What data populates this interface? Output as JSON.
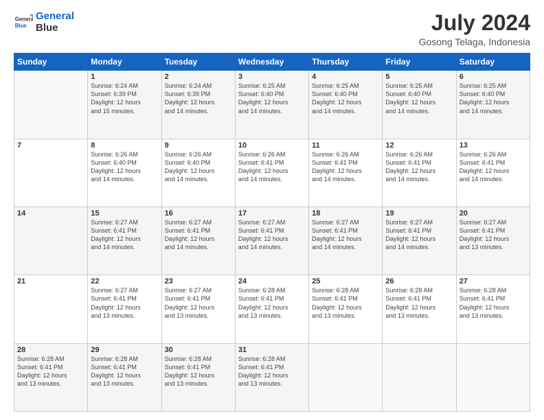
{
  "header": {
    "logo_line1": "General",
    "logo_line2": "Blue",
    "title": "July 2024",
    "subtitle": "Gosong Telaga, Indonesia"
  },
  "weekdays": [
    "Sunday",
    "Monday",
    "Tuesday",
    "Wednesday",
    "Thursday",
    "Friday",
    "Saturday"
  ],
  "weeks": [
    [
      {
        "day": "",
        "info": ""
      },
      {
        "day": "1",
        "info": "Sunrise: 6:24 AM\nSunset: 6:39 PM\nDaylight: 12 hours\nand 15 minutes."
      },
      {
        "day": "2",
        "info": "Sunrise: 6:24 AM\nSunset: 6:39 PM\nDaylight: 12 hours\nand 14 minutes."
      },
      {
        "day": "3",
        "info": "Sunrise: 6:25 AM\nSunset: 6:40 PM\nDaylight: 12 hours\nand 14 minutes."
      },
      {
        "day": "4",
        "info": "Sunrise: 6:25 AM\nSunset: 6:40 PM\nDaylight: 12 hours\nand 14 minutes."
      },
      {
        "day": "5",
        "info": "Sunrise: 6:25 AM\nSunset: 6:40 PM\nDaylight: 12 hours\nand 14 minutes."
      },
      {
        "day": "6",
        "info": "Sunrise: 6:25 AM\nSunset: 6:40 PM\nDaylight: 12 hours\nand 14 minutes."
      }
    ],
    [
      {
        "day": "7",
        "info": ""
      },
      {
        "day": "8",
        "info": "Sunrise: 6:26 AM\nSunset: 6:40 PM\nDaylight: 12 hours\nand 14 minutes."
      },
      {
        "day": "9",
        "info": "Sunrise: 6:26 AM\nSunset: 6:40 PM\nDaylight: 12 hours\nand 14 minutes."
      },
      {
        "day": "10",
        "info": "Sunrise: 6:26 AM\nSunset: 6:41 PM\nDaylight: 12 hours\nand 14 minutes."
      },
      {
        "day": "11",
        "info": "Sunrise: 6:26 AM\nSunset: 6:41 PM\nDaylight: 12 hours\nand 14 minutes."
      },
      {
        "day": "12",
        "info": "Sunrise: 6:26 AM\nSunset: 6:41 PM\nDaylight: 12 hours\nand 14 minutes."
      },
      {
        "day": "13",
        "info": "Sunrise: 6:26 AM\nSunset: 6:41 PM\nDaylight: 12 hours\nand 14 minutes."
      }
    ],
    [
      {
        "day": "14",
        "info": ""
      },
      {
        "day": "15",
        "info": "Sunrise: 6:27 AM\nSunset: 6:41 PM\nDaylight: 12 hours\nand 14 minutes."
      },
      {
        "day": "16",
        "info": "Sunrise: 6:27 AM\nSunset: 6:41 PM\nDaylight: 12 hours\nand 14 minutes."
      },
      {
        "day": "17",
        "info": "Sunrise: 6:27 AM\nSunset: 6:41 PM\nDaylight: 12 hours\nand 14 minutes."
      },
      {
        "day": "18",
        "info": "Sunrise: 6:27 AM\nSunset: 6:41 PM\nDaylight: 12 hours\nand 14 minutes."
      },
      {
        "day": "19",
        "info": "Sunrise: 6:27 AM\nSunset: 6:41 PM\nDaylight: 12 hours\nand 14 minutes."
      },
      {
        "day": "20",
        "info": "Sunrise: 6:27 AM\nSunset: 6:41 PM\nDaylight: 12 hours\nand 13 minutes."
      }
    ],
    [
      {
        "day": "21",
        "info": ""
      },
      {
        "day": "22",
        "info": "Sunrise: 6:27 AM\nSunset: 6:41 PM\nDaylight: 12 hours\nand 13 minutes."
      },
      {
        "day": "23",
        "info": "Sunrise: 6:27 AM\nSunset: 6:41 PM\nDaylight: 12 hours\nand 13 minutes."
      },
      {
        "day": "24",
        "info": "Sunrise: 6:28 AM\nSunset: 6:41 PM\nDaylight: 12 hours\nand 13 minutes."
      },
      {
        "day": "25",
        "info": "Sunrise: 6:28 AM\nSunset: 6:41 PM\nDaylight: 12 hours\nand 13 minutes."
      },
      {
        "day": "26",
        "info": "Sunrise: 6:28 AM\nSunset: 6:41 PM\nDaylight: 12 hours\nand 13 minutes."
      },
      {
        "day": "27",
        "info": "Sunrise: 6:28 AM\nSunset: 6:41 PM\nDaylight: 12 hours\nand 13 minutes."
      }
    ],
    [
      {
        "day": "28",
        "info": "Sunrise: 6:28 AM\nSunset: 6:41 PM\nDaylight: 12 hours\nand 13 minutes."
      },
      {
        "day": "29",
        "info": "Sunrise: 6:28 AM\nSunset: 6:41 PM\nDaylight: 12 hours\nand 13 minutes."
      },
      {
        "day": "30",
        "info": "Sunrise: 6:28 AM\nSunset: 6:41 PM\nDaylight: 12 hours\nand 13 minutes."
      },
      {
        "day": "31",
        "info": "Sunrise: 6:28 AM\nSunset: 6:41 PM\nDaylight: 12 hours\nand 13 minutes."
      },
      {
        "day": "",
        "info": ""
      },
      {
        "day": "",
        "info": ""
      },
      {
        "day": "",
        "info": ""
      }
    ]
  ]
}
